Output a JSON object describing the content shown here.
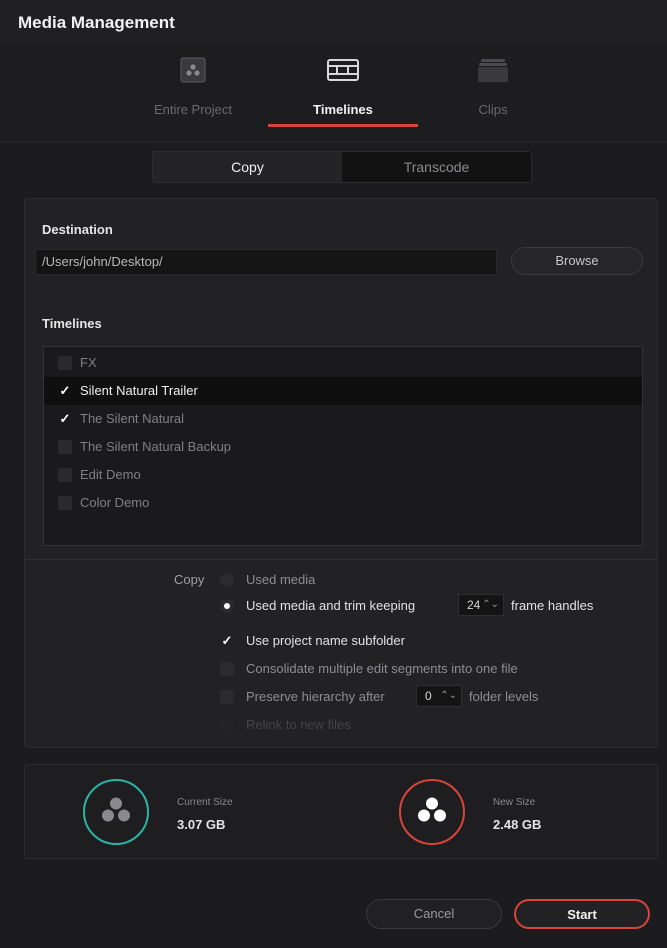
{
  "window": {
    "title": "Media Management"
  },
  "modes": [
    {
      "label": "Entire Project",
      "icon": "project-icon",
      "active": false
    },
    {
      "label": "Timelines",
      "icon": "timeline-icon",
      "active": true
    },
    {
      "label": "Clips",
      "icon": "clips-icon",
      "active": false
    }
  ],
  "segmented": {
    "copy": "Copy",
    "transcode": "Transcode",
    "selected": "Copy"
  },
  "destination": {
    "heading": "Destination",
    "path": "/Users/john/Desktop/",
    "browse": "Browse"
  },
  "timelines": {
    "heading": "Timelines",
    "items": [
      {
        "label": "FX",
        "checked": false,
        "selected": false
      },
      {
        "label": "Silent Natural Trailer",
        "checked": true,
        "selected": true
      },
      {
        "label": "The Silent Natural",
        "checked": true,
        "selected": false
      },
      {
        "label": "The Silent Natural Backup",
        "checked": false,
        "selected": false
      },
      {
        "label": "Edit Demo",
        "checked": false,
        "selected": false
      },
      {
        "label": "Color Demo",
        "checked": false,
        "selected": false
      }
    ]
  },
  "copy_options": {
    "label": "Copy",
    "used_media": "Used media",
    "used_trim_prefix": "Used media and trim keeping",
    "frame_handles_value": "24",
    "frame_handles_suffix": "frame handles",
    "selected": "used_trim",
    "use_project_subfolder": "Use project name subfolder",
    "use_project_subfolder_checked": true,
    "consolidate": "Consolidate multiple edit segments into one file",
    "consolidate_checked": false,
    "preserve_prefix": "Preserve hierarchy after",
    "preserve_value": "0",
    "preserve_suffix": "folder levels",
    "preserve_checked": false,
    "relink": "Relink to new files",
    "relink_checked": false
  },
  "sizes": {
    "current_label": "Current Size",
    "current_value": "3.07 GB",
    "new_label": "New Size",
    "new_value": "2.48 GB"
  },
  "footer": {
    "cancel": "Cancel",
    "start": "Start"
  },
  "colors": {
    "accent": "#d9443a",
    "teal": "#28b5a6"
  }
}
